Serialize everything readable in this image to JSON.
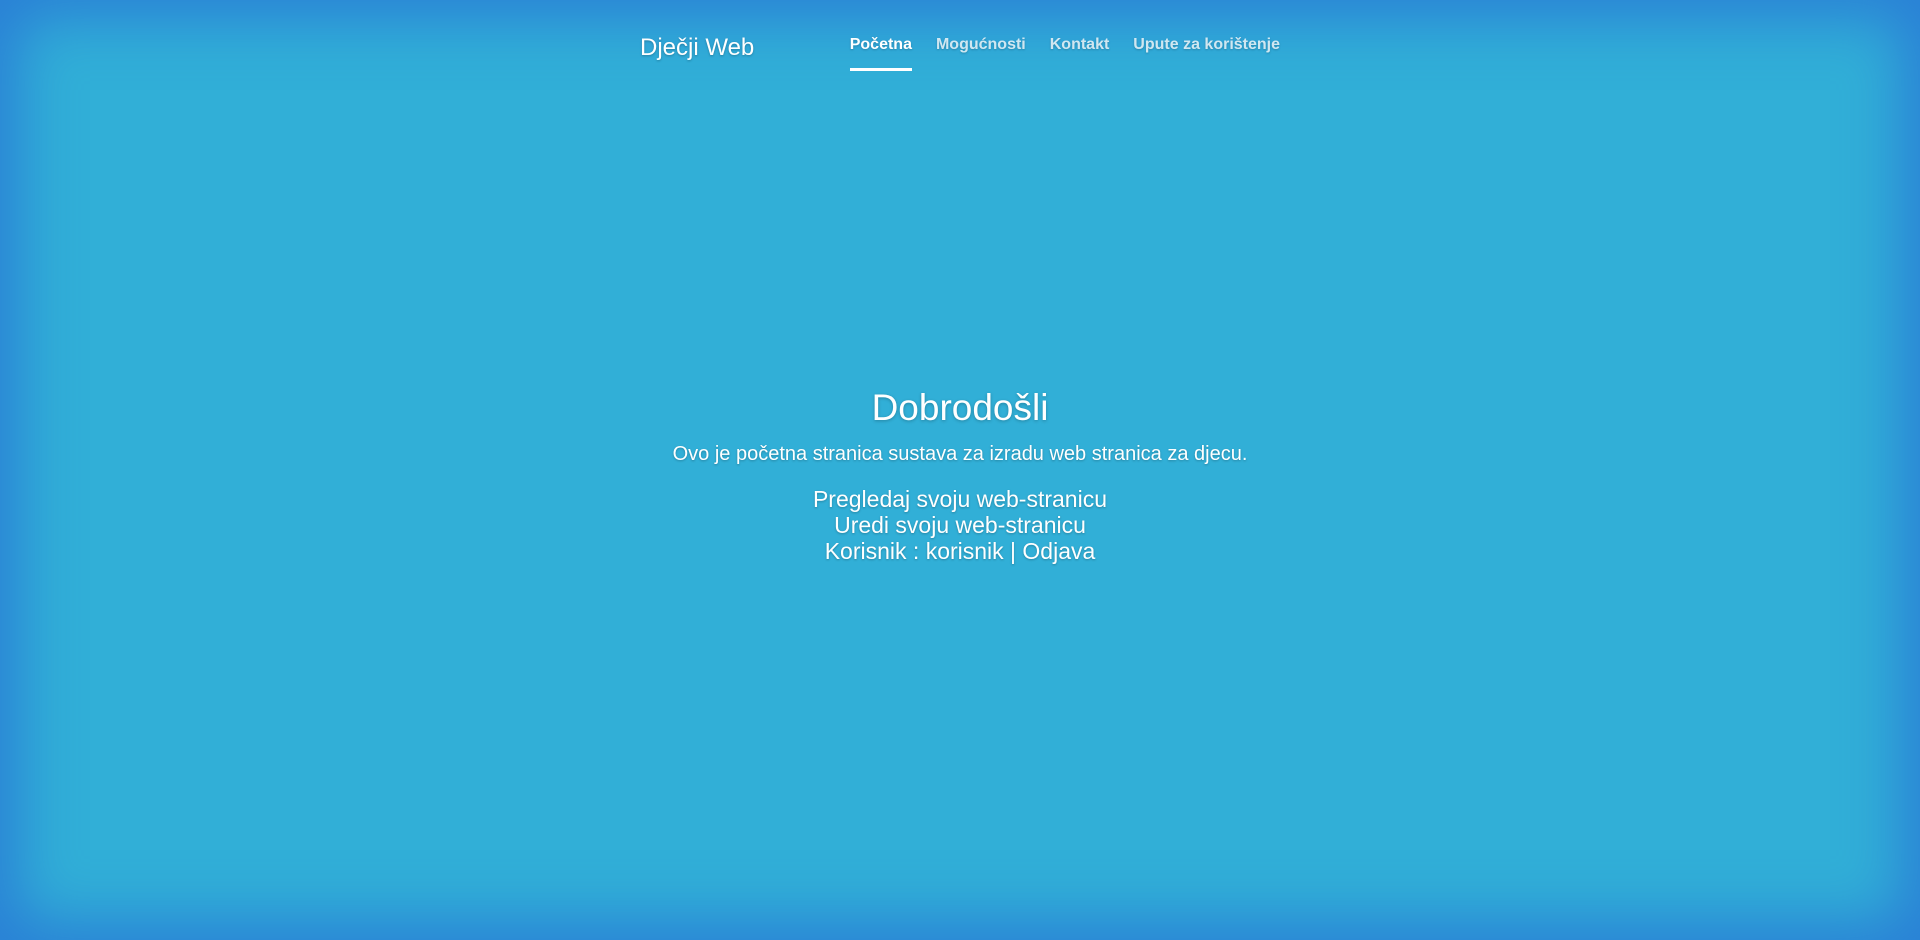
{
  "header": {
    "brand": "Dječji Web",
    "nav": [
      {
        "label": "Početna",
        "active": true
      },
      {
        "label": "Mogućnosti",
        "active": false
      },
      {
        "label": "Kontakt",
        "active": false
      },
      {
        "label": "Upute za korištenje",
        "active": false
      }
    ]
  },
  "main": {
    "title": "Dobrodošli",
    "lead": "Ovo je početna stranica sustava za izradu web stranica za djecu.",
    "view_link": "Pregledaj svoju web-stranicu",
    "edit_link": "Uredi svoju web-stranicu",
    "user_label": "Korisnik : ",
    "username": "korisnik",
    "separator": " | ",
    "logout_link": "Odjava"
  },
  "colors": {
    "background": "#31afd7",
    "vignette": "#2a7fd6",
    "text": "#ffffff"
  }
}
